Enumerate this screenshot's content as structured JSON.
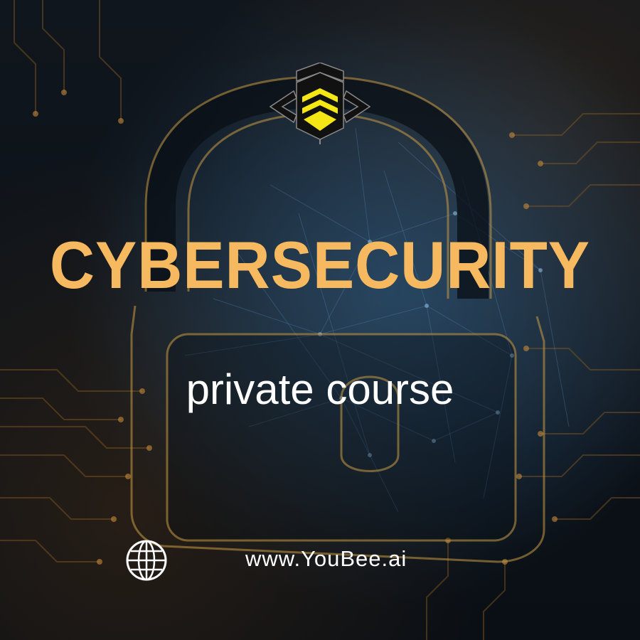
{
  "poster": {
    "title": "CYBERSECURITY",
    "subtitle": "private course",
    "website": "www.YouBee.ai"
  },
  "icons": {
    "logo": "bee-logo-icon",
    "background": "padlock-icon",
    "website": "globe-icon"
  },
  "colors": {
    "title": "#f6b95f",
    "subtitle": "#ffffff",
    "logo_accent": "#f5e616",
    "padlock_outline": "#c89a45",
    "background": "#0b1016"
  }
}
